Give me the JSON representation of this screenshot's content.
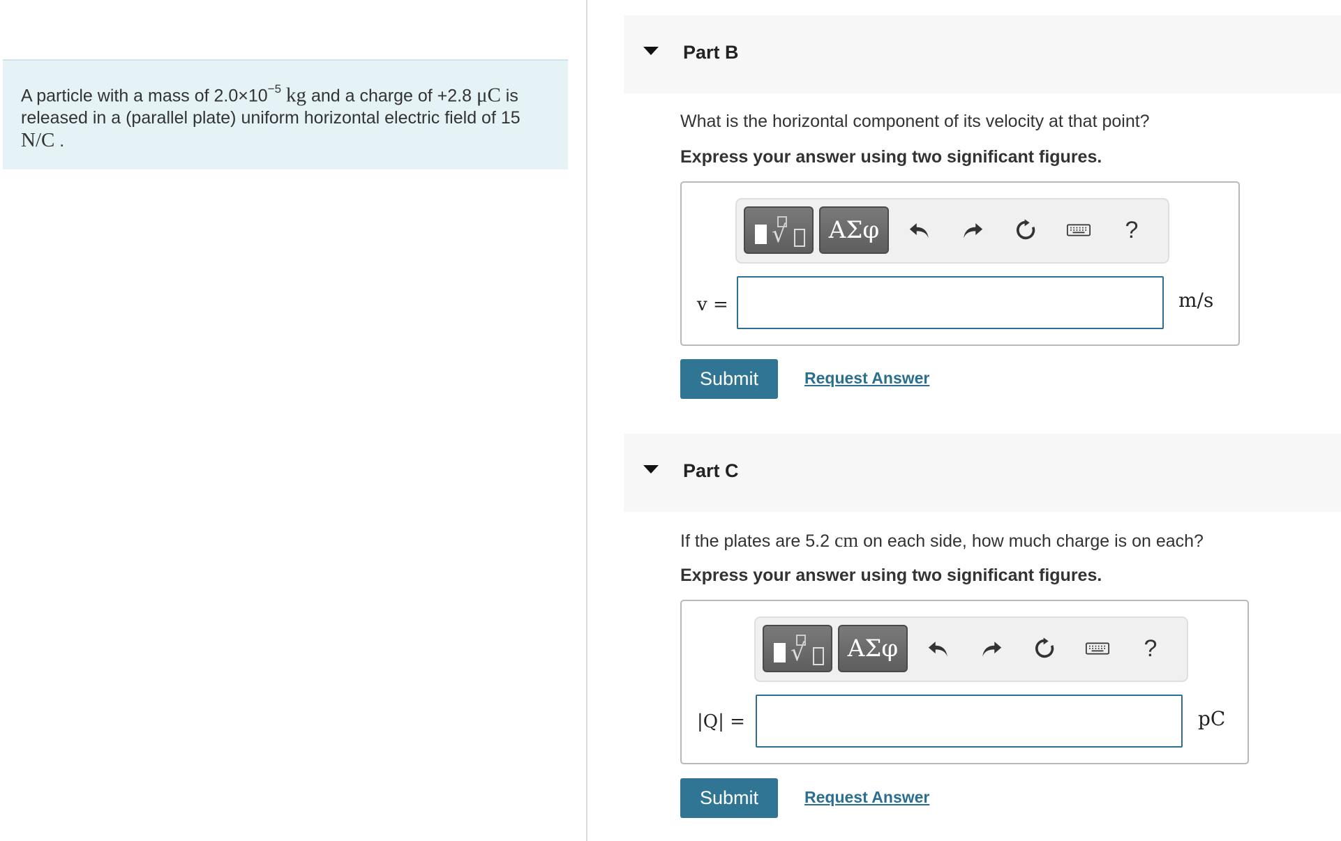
{
  "problem": {
    "text_1": "A particle with a mass of 2.0×10",
    "exponent": "−5",
    "unit_mass": "kg",
    "text_2": " and a charge of +2.8 ",
    "unit_charge": "μC",
    "text_3": " is released in a (parallel plate) uniform horizontal electric field of 15 ",
    "unit_field": "N/C",
    "text_4": " ."
  },
  "part_b": {
    "title": "Part B",
    "question": "What is the horizontal component of its velocity at that point?",
    "instruction": "Express your answer using two significant figures.",
    "toolbar": {
      "greek_label": "ΑΣφ",
      "help_label": "?"
    },
    "variable_label": "v =",
    "input_value": "",
    "unit": "m/s",
    "submit_label": "Submit",
    "request_label": "Request Answer"
  },
  "part_c": {
    "title": "Part C",
    "question_1": "If the plates are 5.2 ",
    "question_unit": "cm",
    "question_2": " on each side, how much charge is on each?",
    "instruction": "Express your answer using two significant figures.",
    "toolbar": {
      "greek_label": "ΑΣφ",
      "help_label": "?"
    },
    "variable_label": "|Q| =",
    "input_value": "",
    "unit": "pC",
    "submit_label": "Submit",
    "request_label": "Request Answer"
  },
  "icons": [
    "templates-icon",
    "greek-letters-icon",
    "undo-icon",
    "redo-icon",
    "reset-icon",
    "keyboard-icon",
    "help-icon",
    "collapse-caret-icon"
  ],
  "colors": {
    "accent": "#307593",
    "link": "#2a6f8f",
    "input_border": "#2e6e8e",
    "intro_bg": "#e6f3f6"
  }
}
